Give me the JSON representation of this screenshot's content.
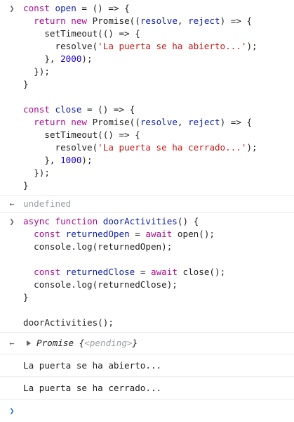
{
  "entries": [
    {
      "type": "input",
      "gutter": "❯",
      "lines": [
        [
          [
            "kw",
            "const "
          ],
          [
            "var",
            "open"
          ],
          [
            "p",
            " = () => {"
          ]
        ],
        [
          [
            "p",
            "  "
          ],
          [
            "kw",
            "return new "
          ],
          [
            "p",
            "Promise(("
          ],
          [
            "var",
            "resolve"
          ],
          [
            "p",
            ", "
          ],
          [
            "var",
            "reject"
          ],
          [
            "p",
            ") => {"
          ]
        ],
        [
          [
            "p",
            "    setTimeout(() => {"
          ]
        ],
        [
          [
            "p",
            "      resolve("
          ],
          [
            "str",
            "'La puerta se ha abierto...'"
          ],
          [
            "p",
            ");"
          ]
        ],
        [
          [
            "p",
            "    }, "
          ],
          [
            "num",
            "2000"
          ],
          [
            "p",
            ");"
          ]
        ],
        [
          [
            "p",
            "  });"
          ]
        ],
        [
          [
            "p",
            "}"
          ]
        ],
        [
          [
            "p",
            ""
          ]
        ],
        [
          [
            "kw",
            "const "
          ],
          [
            "var",
            "close"
          ],
          [
            "p",
            " = () => {"
          ]
        ],
        [
          [
            "p",
            "  "
          ],
          [
            "kw",
            "return new "
          ],
          [
            "p",
            "Promise(("
          ],
          [
            "var",
            "resolve"
          ],
          [
            "p",
            ", "
          ],
          [
            "var",
            "reject"
          ],
          [
            "p",
            ") => {"
          ]
        ],
        [
          [
            "p",
            "    setTimeout(() => {"
          ]
        ],
        [
          [
            "p",
            "      resolve("
          ],
          [
            "str",
            "'La puerta se ha cerrado...'"
          ],
          [
            "p",
            ");"
          ]
        ],
        [
          [
            "p",
            "    }, "
          ],
          [
            "num",
            "1000"
          ],
          [
            "p",
            ");"
          ]
        ],
        [
          [
            "p",
            "  });"
          ]
        ],
        [
          [
            "p",
            "}"
          ]
        ]
      ]
    },
    {
      "type": "result",
      "gutter": "←",
      "lines": [
        [
          [
            "muted",
            "undefined"
          ]
        ]
      ]
    },
    {
      "type": "input",
      "gutter": "❯",
      "lines": [
        [
          [
            "kw",
            "async function "
          ],
          [
            "var",
            "doorActivities"
          ],
          [
            "p",
            "() {"
          ]
        ],
        [
          [
            "p",
            "  "
          ],
          [
            "kw",
            "const "
          ],
          [
            "var",
            "returnedOpen"
          ],
          [
            "p",
            " = "
          ],
          [
            "kw",
            "await "
          ],
          [
            "p",
            "open();"
          ]
        ],
        [
          [
            "p",
            "  console.log(returnedOpen);"
          ]
        ],
        [
          [
            "p",
            ""
          ]
        ],
        [
          [
            "p",
            "  "
          ],
          [
            "kw",
            "const "
          ],
          [
            "var",
            "returnedClose"
          ],
          [
            "p",
            " = "
          ],
          [
            "kw",
            "await "
          ],
          [
            "p",
            "close();"
          ]
        ],
        [
          [
            "p",
            "  console.log(returnedClose);"
          ]
        ],
        [
          [
            "p",
            "}"
          ]
        ],
        [
          [
            "p",
            ""
          ]
        ],
        [
          [
            "p",
            "doorActivities();"
          ]
        ]
      ]
    },
    {
      "type": "promise",
      "gutter": "←",
      "promise_label": "Promise",
      "state_open": " {",
      "state": "<pending>",
      "state_close": "}"
    },
    {
      "type": "log",
      "text": "La puerta se ha abierto..."
    },
    {
      "type": "log",
      "text": "La puerta se ha cerrado..."
    }
  ],
  "prompt": {
    "gutter": "❯"
  },
  "colors": {
    "keyword": "#a90d91",
    "string": "#c41a16",
    "number": "#1c00cf",
    "variable": "#0d22aa",
    "muted": "#9aa0a6",
    "separator": "#e8eaed",
    "prompt": "#1a73e8"
  }
}
